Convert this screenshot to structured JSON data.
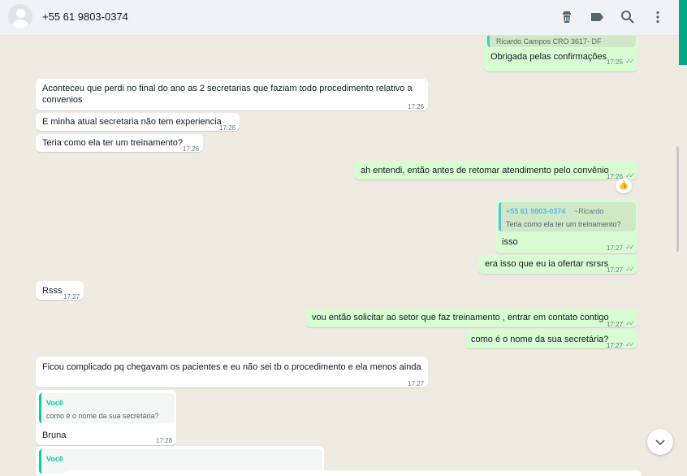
{
  "header": {
    "contact_name": "+55 61 9803-0374",
    "icons": [
      "trash-icon",
      "label-icon",
      "search-icon",
      "menu-dots-icon"
    ]
  },
  "messages": [
    {
      "direction": "out",
      "quote_text": "Ricardo Campos CRO 3617- DF",
      "text": "Obrigada pelas confirmações",
      "time": "17:25",
      "status": "read"
    },
    {
      "direction": "in",
      "text_line1": "Aconteceu que perdi no final do ano as 2 secretarias que faziam todo procedimento relativo a",
      "text_line2": "convenios",
      "time": "17:26"
    },
    {
      "direction": "in",
      "text": "E minha atual secretaria não  tem experiencia",
      "time": "17:26"
    },
    {
      "direction": "in",
      "text": "Teria como ela ter um treinamento?",
      "time": "17:26"
    },
    {
      "direction": "out",
      "text": "ah entendi, então antes de retomar atendimento pelo convênio",
      "time": "17:26",
      "status": "read",
      "reaction": "👍"
    },
    {
      "direction": "out",
      "quote_name": "+55 61 9803-0374",
      "quote_sub": "~Ricardo",
      "quote_text": "Teria como ela ter um treinamento?",
      "text": "isso",
      "time": "17:27",
      "status": "read"
    },
    {
      "direction": "out",
      "text": "era isso que eu ia ofertar rsrsrs",
      "time": "17:27",
      "status": "read"
    },
    {
      "direction": "in",
      "text": "Rsss",
      "time": "17:27"
    },
    {
      "direction": "out",
      "text": "vou então solicitar ao setor que faz treinamento , entrar em contato contigo",
      "time": "17:27",
      "status": "read"
    },
    {
      "direction": "out",
      "text": "como é o nome da sua secretária?",
      "time": "17:27",
      "status": "read"
    },
    {
      "direction": "in",
      "text": "Ficou complicado pq chegavam os pacientes e eu não  sei tb o procedimento e ela menos ainda",
      "time": "17:27"
    },
    {
      "direction": "in",
      "quote_name": "Você",
      "quote_text": "como é o nome da sua secretária?",
      "text": "Bruna",
      "time": "17:28"
    },
    {
      "direction": "in",
      "quote_name": "Você"
    }
  ],
  "colors": {
    "outgoing_bubble": "#d9fdd3",
    "incoming_bubble": "#ffffff",
    "chat_background": "#efeae2",
    "quote_accent_blue": "#53bdeb",
    "quote_accent_green": "#06cf9c"
  },
  "scroll_down_icon": "chevron-down-icon"
}
